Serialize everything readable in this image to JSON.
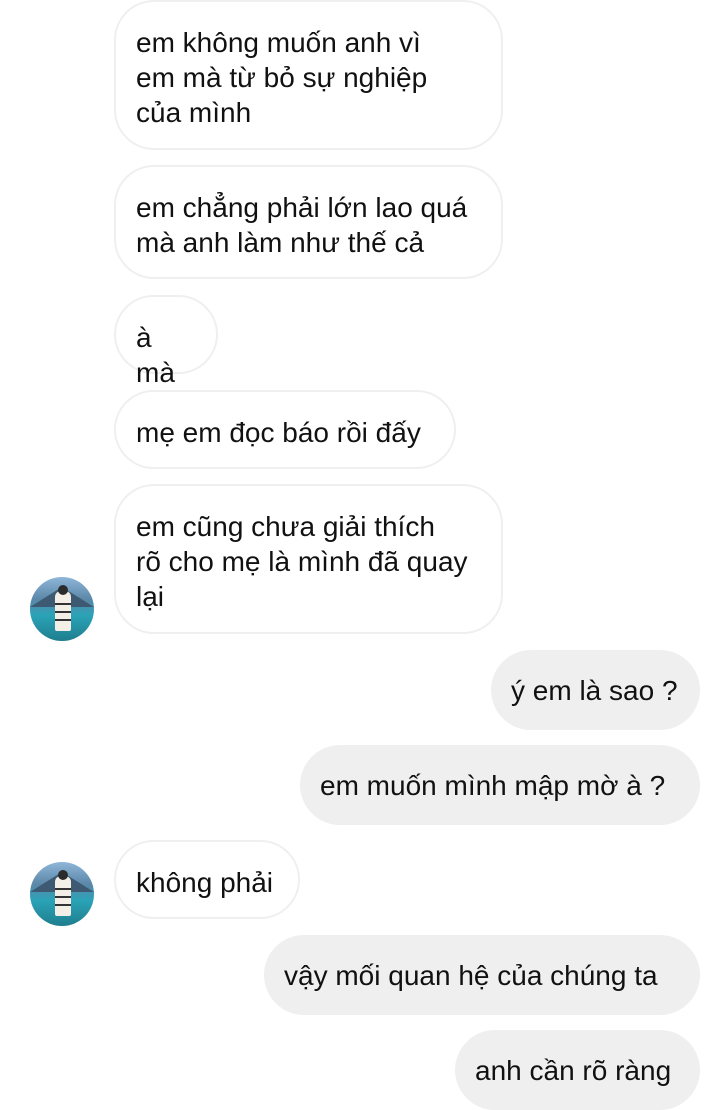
{
  "conversation": {
    "messages": [
      {
        "direction": "incoming",
        "text": "em không muốn anh vì\nem mà từ bỏ sự nghiệp\ncủa mình"
      },
      {
        "direction": "incoming",
        "text": "em chẳng phải lớn lao quá\nmà anh làm như thế cả"
      },
      {
        "direction": "incoming",
        "text": "à mà"
      },
      {
        "direction": "incoming",
        "text": "mẹ em đọc báo rồi đấy"
      },
      {
        "direction": "incoming",
        "text": "em cũng chưa giải thích\nrõ cho mẹ là mình đã quay\nlại"
      },
      {
        "direction": "outgoing",
        "text": "ý em là sao ?"
      },
      {
        "direction": "outgoing",
        "text": "em muốn mình mập mờ à ?"
      },
      {
        "direction": "incoming",
        "text": "không phải"
      },
      {
        "direction": "outgoing",
        "text": "vậy mối quan hệ của chúng ta"
      },
      {
        "direction": "outgoing",
        "text": "anh cần rõ ràng"
      }
    ],
    "avatar_icon": "contact-avatar-photo",
    "colors": {
      "incoming_bg": "#ffffff",
      "incoming_border": "#efefef",
      "outgoing_bg": "#efefef",
      "text": "#111111"
    }
  }
}
